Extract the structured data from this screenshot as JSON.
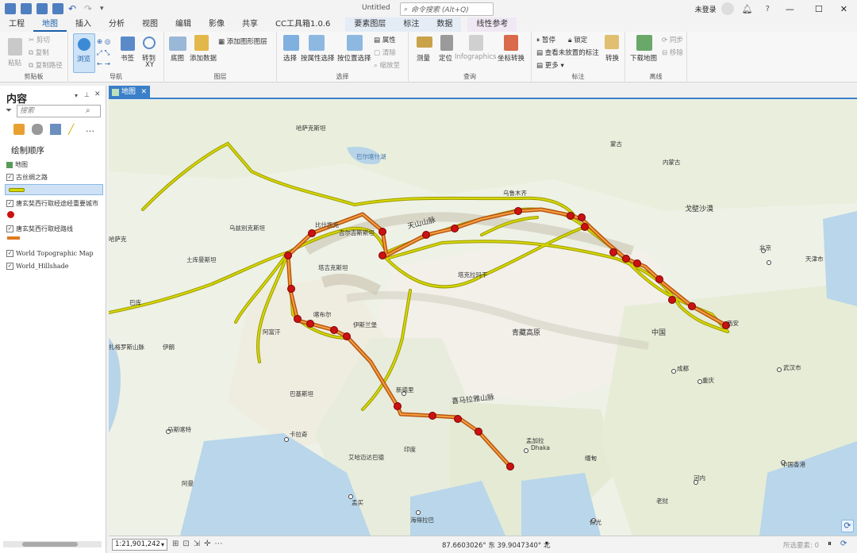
{
  "window": {
    "title": "Untitled",
    "search_placeholder": "命令搜索 (Alt+Q)",
    "user": "未登录",
    "help": "?"
  },
  "tabs": [
    {
      "label": "工程"
    },
    {
      "label": "地图",
      "active": true
    },
    {
      "label": "插入"
    },
    {
      "label": "分析"
    },
    {
      "label": "视图"
    },
    {
      "label": "编辑"
    },
    {
      "label": "影像"
    },
    {
      "label": "共享"
    },
    {
      "label": "CC工具箱1.0.6"
    }
  ],
  "context_tabs": [
    {
      "label": "要素图层"
    },
    {
      "label": "标注"
    },
    {
      "label": "数据"
    }
  ],
  "extra_tab": "线性参考",
  "ribbon": {
    "clipboard": {
      "label": "剪贴板",
      "paste": "粘贴",
      "cut": "剪切",
      "copy": "复制",
      "copy_path": "复制路径"
    },
    "navigate": {
      "label": "导航",
      "explore": "浏览",
      "bookmarks": "书签",
      "goto": "转到",
      "goto2": "XY"
    },
    "layer": {
      "label": "图层",
      "basemap": "底图",
      "add_data": "添加数据",
      "add_graphics": "添加图形图层"
    },
    "selection": {
      "label": "选择",
      "select": "选择",
      "by_attr": "按属性选择",
      "by_loc": "按位置选择",
      "attributes": "属性",
      "clear": "清除",
      "zoom_to": "缩放至"
    },
    "inquiry": {
      "label": "查询",
      "measure": "测量",
      "locate": "定位",
      "infographics": "Infographics",
      "coord": "坐标转换"
    },
    "labeling": {
      "label": "标注",
      "pause": "暂停",
      "lock": "锁定",
      "view_unplaced": "查看未放置的标注",
      "more": "更多",
      "convert": "转换"
    },
    "offline": {
      "label": "离线",
      "download": "下载地图",
      "sync": "同步",
      "remove": "移除"
    }
  },
  "panel": {
    "title": "内容",
    "search_placeholder": "搜索",
    "draw_order": "绘制顺序",
    "map_node": "地图",
    "layers": [
      "古丝绸之路",
      "唐玄奘西行取经途经重要城市",
      "唐玄奘西行取经路线",
      "World Topographic Map",
      "World_Hillshade"
    ]
  },
  "map_tab": "地图",
  "status": {
    "scale": "1:21,901,242",
    "coords": "87.6603026° 东  39.9047340° 北",
    "selected": "所选要素: 0"
  },
  "map_labels": {
    "kazakhstan": "哈萨克斯坦",
    "mongolia": "蒙古",
    "inner_mongolia": "内蒙古",
    "gobi": "戈壁沙漠",
    "balkhash": "巴尔喀什湖",
    "tianshan": "天山山脉",
    "kyrgyz": "吉尔吉斯斯坦",
    "uzbek": "乌兹别克斯坦",
    "turkmen": "土库曼斯坦",
    "tajik": "塔吉克斯坦",
    "afghan": "阿富汗",
    "iran": "伊朗",
    "pakistan": "巴基斯坦",
    "india": "印度",
    "nepal_hima": "喜马拉雅山脉",
    "qinghai": "青藏高原",
    "china": "中国",
    "beijing": "北京",
    "tianjin": "天津市",
    "xian": "西安",
    "chengdu": "成都",
    "chongqing": "重庆",
    "wuhan": "武汉市",
    "hongkong": "中国香港",
    "newdelhi": "新德里",
    "karachi": "卡拉奇",
    "ahmedabad": "艾哈迈达巴德",
    "mumbai": "孟买",
    "hyderabad": "海得拉巴",
    "dhaka": "Dhaka",
    "bangla": "孟加拉",
    "myanmar": "缅甸",
    "hanoi": "河内",
    "laos": "老挝",
    "islamabad": "伊斯兰堡",
    "kabul": "喀布尔",
    "oman": "阿曼",
    "taklamakan": "塔克拉玛干",
    "urumqi": "乌鲁木齐",
    "baku": "巴库",
    "muscat": "马斯喀特",
    "zagros": "扎格罗斯山脉",
    "bishkek": "比什凯克",
    "ghaz": "哈萨克",
    "yangon": "仰光"
  },
  "colors": {
    "accent": "#1a5fa8",
    "silk_road": "#b8b800",
    "xuanzang": "#e07a1f",
    "city": "#cc1111"
  }
}
